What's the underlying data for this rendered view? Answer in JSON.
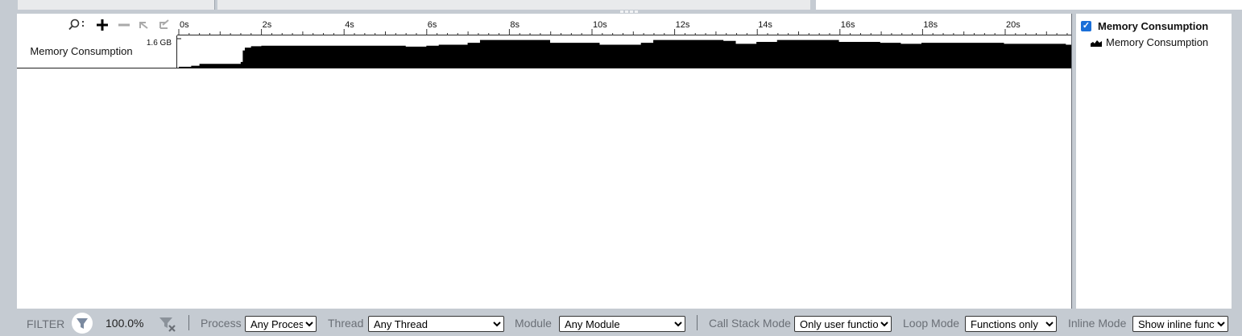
{
  "toolbar": {
    "icons": [
      "search-icon",
      "zoom-in-icon",
      "zoom-out-icon",
      "undo-zoom-icon",
      "reset-zoom-icon"
    ],
    "search_suffix": ":"
  },
  "timeline": {
    "ticks": [
      "0s",
      "2s",
      "4s",
      "6s",
      "8s",
      "10s",
      "12s",
      "14s",
      "16s",
      "18s",
      "20s"
    ],
    "row_label": "Memory Consumption",
    "row_scale": "1.6 GB"
  },
  "chart_data": {
    "type": "area",
    "xlabel": "",
    "ylabel": "",
    "xlim": [
      0,
      21.65
    ],
    "ylim": [
      0,
      1.6
    ],
    "ymax_label": "1.6 GB",
    "series": [
      {
        "name": "Memory Consumption",
        "color": "#000000",
        "x": [
          0.0,
          0.3,
          0.5,
          1.0,
          1.5,
          1.55,
          1.6,
          1.75,
          2.0,
          5.5,
          6.0,
          6.3,
          7.0,
          7.3,
          9.0,
          10.2,
          11.2,
          11.5,
          13.2,
          13.5,
          14.0,
          14.5,
          16.0,
          17.0,
          17.5,
          18.0,
          20.0,
          21.5,
          21.65
        ],
        "y": [
          0.05,
          0.1,
          0.2,
          0.2,
          0.3,
          0.9,
          1.05,
          1.12,
          1.15,
          1.1,
          1.15,
          1.2,
          1.3,
          1.45,
          1.3,
          1.2,
          1.3,
          1.45,
          1.4,
          1.25,
          1.35,
          1.45,
          1.35,
          1.3,
          1.25,
          1.3,
          1.25,
          1.2,
          1.1
        ]
      }
    ]
  },
  "legend": {
    "group_label": "Memory Consumption",
    "item_label": "Memory Consumption",
    "checked": true,
    "item_icon": "area-chart-icon"
  },
  "filter_bar": {
    "filter_label": "FILTER",
    "percentage": "100.0%",
    "process_label": "Process",
    "process_value": "Any Process",
    "thread_label": "Thread",
    "thread_value": "Any Thread",
    "module_label": "Module",
    "module_value": "Any Module",
    "callstack_label": "Call Stack Mode",
    "callstack_value": "Only user functions",
    "loop_label": "Loop Mode",
    "loop_value": "Functions only",
    "inline_label": "Inline Mode",
    "inline_value": "Show inline functions"
  },
  "colors": {
    "chrome": "#c5cbd2",
    "accent": "#1a6fd8",
    "plot_fill": "#000000"
  }
}
